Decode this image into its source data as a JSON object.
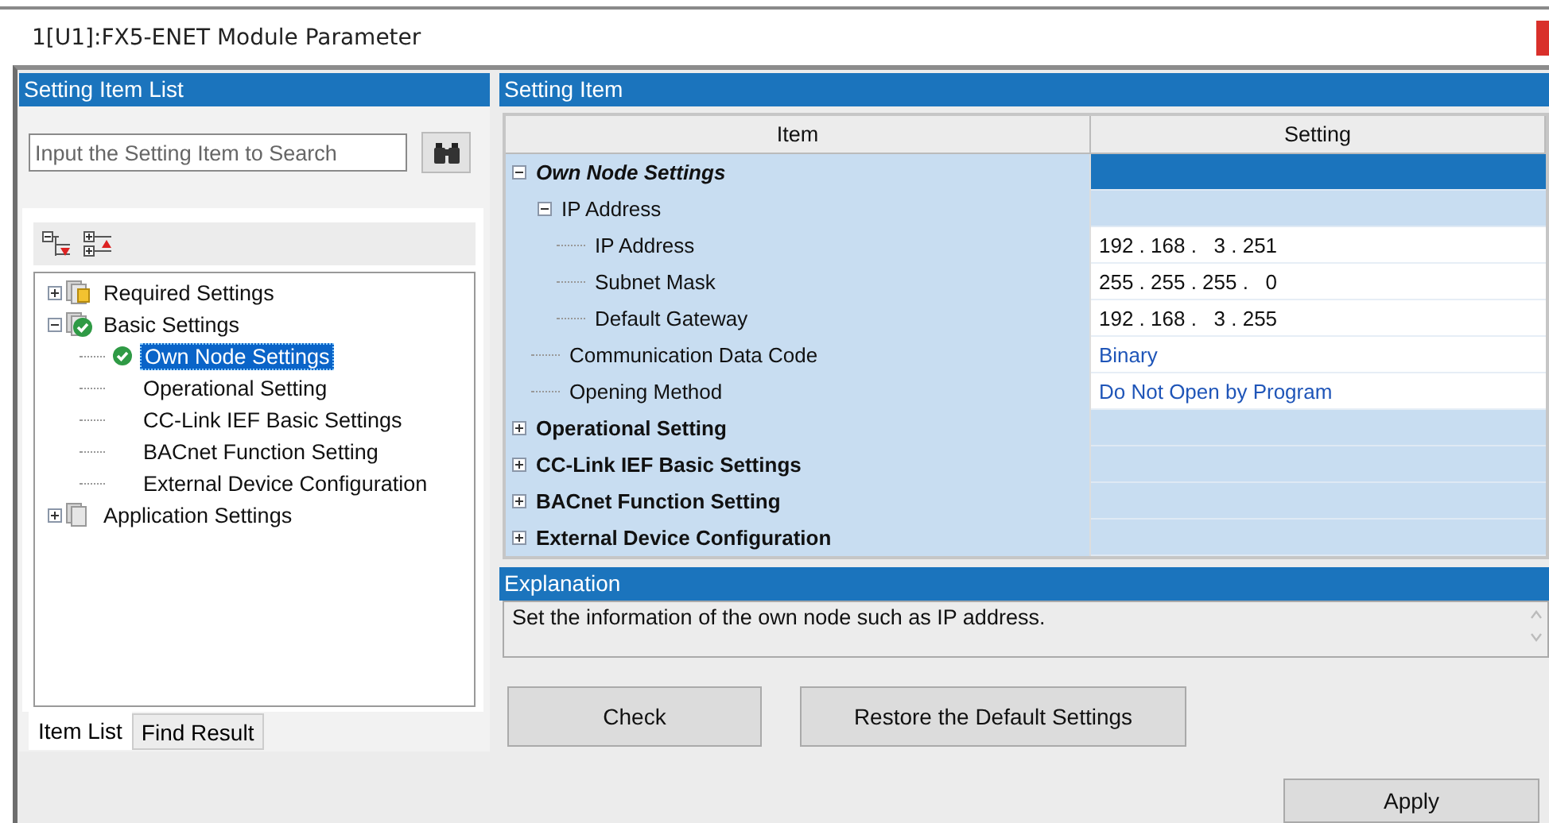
{
  "window": {
    "title": "1[U1]:FX5-ENET Module Parameter"
  },
  "left_panel": {
    "title": "Setting Item List",
    "search": {
      "placeholder": "Input the Setting Item to Search"
    },
    "tree": [
      {
        "label": "Required Settings",
        "kind": "lockfolder",
        "checked": false,
        "expanded": false,
        "selected": false
      },
      {
        "label": "Basic Settings",
        "kind": "folder",
        "checked": true,
        "expanded": true,
        "selected": false,
        "children": [
          {
            "label": "Own Node Settings",
            "kind": "item",
            "checked": true,
            "selected": true
          },
          {
            "label": "Operational Setting",
            "kind": "item",
            "checked": false,
            "selected": false
          },
          {
            "label": "CC-Link IEF Basic Settings",
            "kind": "item",
            "checked": false,
            "selected": false
          },
          {
            "label": "BACnet Function Setting",
            "kind": "item",
            "checked": false,
            "selected": false
          },
          {
            "label": "External Device Configuration",
            "kind": "item",
            "checked": false,
            "selected": false
          }
        ]
      },
      {
        "label": "Application Settings",
        "kind": "folder",
        "checked": false,
        "expanded": false,
        "selected": false
      }
    ],
    "tabs": [
      {
        "label": "Item List",
        "selected": true
      },
      {
        "label": "Find Result",
        "selected": false
      }
    ]
  },
  "right_panel": {
    "title": "Setting Item",
    "columns": [
      "Item",
      "Setting"
    ],
    "rows": [
      {
        "item": "Own Node Settings",
        "selected": true,
        "expanded": true,
        "children": [
          {
            "item": "IP Address",
            "selected": false,
            "expanded": true,
            "children": [
              {
                "item": "IP Address",
                "selected": false,
                "setting": "192 . 168 .   3 . 251",
                "kind": "text"
              },
              {
                "item": "Subnet Mask",
                "selected": false,
                "setting": "255 . 255 . 255 .   0",
                "kind": "text"
              },
              {
                "item": "Default Gateway",
                "selected": false,
                "setting": "192 . 168 .   3 . 255",
                "kind": "text"
              }
            ]
          },
          {
            "item": "Communication Data Code",
            "selected": false,
            "setting": "Binary",
            "kind": "choice"
          },
          {
            "item": "Opening Method",
            "selected": false,
            "setting": "Do Not Open by Program",
            "kind": "choice"
          }
        ]
      },
      {
        "item": "Operational Setting",
        "selected": false,
        "expanded": false
      },
      {
        "item": "CC-Link IEF Basic Settings",
        "selected": false,
        "expanded": false
      },
      {
        "item": "BACnet Function Setting",
        "selected": false,
        "expanded": false
      },
      {
        "item": "External Device Configuration",
        "selected": false,
        "expanded": false
      }
    ],
    "explanation": {
      "title": "Explanation",
      "text": "Set the information of the own node such as IP address."
    },
    "buttons": [
      "Check",
      "Restore the Default Settings"
    ]
  },
  "footer": {
    "buttons": [
      "Apply"
    ]
  }
}
